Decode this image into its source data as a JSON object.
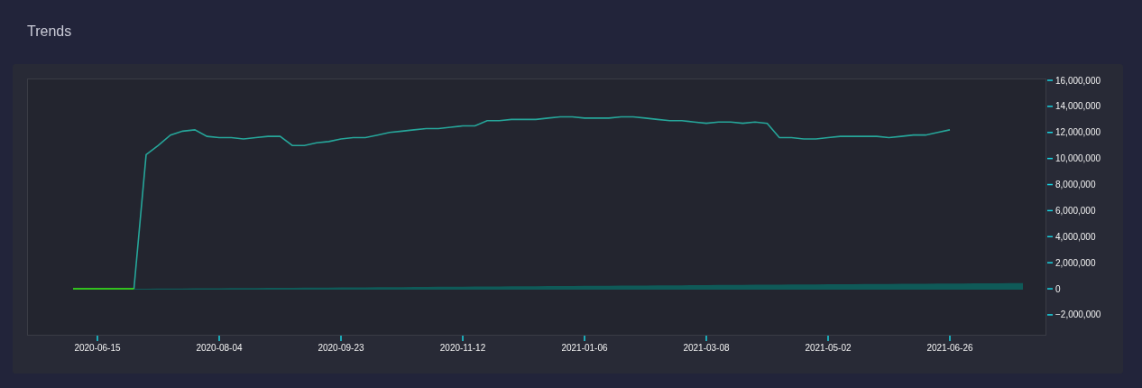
{
  "header": {
    "title": "Trends"
  },
  "chart": {
    "chart_data": {
      "type": "line",
      "ylim": [
        -3530000,
        16140000
      ],
      "categories": [
        null,
        null,
        null,
        null,
        null,
        null,
        "2020-06-15",
        null,
        null,
        null,
        null,
        null,
        null,
        null,
        null,
        null,
        "2020-08-04",
        null,
        null,
        null,
        null,
        null,
        null,
        null,
        null,
        null,
        "2020-09-23",
        null,
        null,
        null,
        null,
        null,
        null,
        null,
        null,
        null,
        "2020-11-12",
        null,
        null,
        null,
        null,
        null,
        null,
        null,
        null,
        null,
        "2021-01-06",
        null,
        null,
        null,
        null,
        null,
        null,
        null,
        null,
        null,
        "2021-03-08",
        null,
        null,
        null,
        null,
        null,
        null,
        null,
        null,
        null,
        "2021-05-02",
        null,
        null,
        null,
        null,
        null,
        null,
        null,
        null,
        null,
        "2021-06-26",
        null,
        null,
        null,
        null,
        null,
        null
      ],
      "yticks": [
        {
          "value": -2000000,
          "label": "−2,000,000"
        },
        {
          "value": 0,
          "label": "0"
        },
        {
          "value": 2000000,
          "label": "2,000,000"
        },
        {
          "value": 4000000,
          "label": "4,000,000"
        },
        {
          "value": 6000000,
          "label": "6,000,000"
        },
        {
          "value": 8000000,
          "label": "8,000,000"
        },
        {
          "value": 10000000,
          "label": "10,000,000"
        },
        {
          "value": 12000000,
          "label": "12,000,000"
        },
        {
          "value": 14000000,
          "label": "14,000,000"
        },
        {
          "value": 16000000,
          "label": "16,000,000"
        }
      ],
      "series": [
        {
          "type": "line",
          "color": "#26a69a",
          "values": [
            null,
            null,
            null,
            null,
            null,
            null,
            null,
            null,
            null,
            0,
            10300000,
            11000000,
            11800000,
            12100000,
            12200000,
            11700000,
            11600000,
            11600000,
            11500000,
            11600000,
            11700000,
            11700000,
            11000000,
            11000000,
            11200000,
            11300000,
            11500000,
            11600000,
            11600000,
            11800000,
            12000000,
            12100000,
            12200000,
            12300000,
            12300000,
            12400000,
            12500000,
            12500000,
            12900000,
            12900000,
            13000000,
            13000000,
            13000000,
            13100000,
            13200000,
            13200000,
            13100000,
            13100000,
            13100000,
            13200000,
            13200000,
            13100000,
            13000000,
            12900000,
            12900000,
            12800000,
            12700000,
            12800000,
            12800000,
            12700000,
            12800000,
            12700000,
            11600000,
            11600000,
            11500000,
            11500000,
            11600000,
            11700000,
            11700000,
            11700000,
            11700000,
            11600000,
            11700000,
            11800000,
            11800000,
            12000000,
            12200000,
            null,
            null,
            null,
            null,
            null,
            null
          ]
        },
        {
          "type": "area",
          "color": "#0f5a58",
          "values": [
            null,
            null,
            null,
            null,
            null,
            null,
            null,
            null,
            null,
            0,
            6000,
            12000,
            18000,
            24000,
            30000,
            36000,
            42000,
            48000,
            54000,
            60000,
            66000,
            72000,
            78000,
            84000,
            90000,
            96000,
            102000,
            108000,
            114000,
            120000,
            126000,
            132000,
            138000,
            144000,
            150000,
            156000,
            162000,
            168000,
            174000,
            180000,
            186000,
            192000,
            198000,
            204000,
            210000,
            216000,
            222000,
            228000,
            234000,
            240000,
            246000,
            252000,
            258000,
            264000,
            270000,
            276000,
            282000,
            288000,
            294000,
            300000,
            306000,
            312000,
            318000,
            324000,
            330000,
            336000,
            342000,
            348000,
            354000,
            360000,
            366000,
            372000,
            378000,
            384000,
            390000,
            396000,
            402000,
            408000,
            414000,
            420000,
            426000,
            432000,
            438000
          ]
        },
        {
          "type": "line",
          "color": "#39f51a",
          "values": [
            null,
            null,
            null,
            null,
            0,
            0,
            0,
            0,
            0,
            0,
            null,
            null,
            null,
            null,
            null,
            null,
            null,
            null,
            null,
            null,
            null,
            null,
            null,
            null,
            null,
            null,
            null,
            null,
            null,
            null,
            null,
            null,
            null,
            null,
            null,
            null,
            null,
            null,
            null,
            null,
            null,
            null,
            null,
            null,
            null,
            null,
            null,
            null,
            null,
            null,
            null,
            null,
            null,
            null,
            null,
            null,
            null,
            null,
            null,
            null,
            null,
            null,
            null,
            null,
            null,
            null,
            null,
            null,
            null,
            null,
            null,
            null,
            null,
            null,
            null,
            null,
            null,
            null,
            null,
            null,
            null,
            null,
            null
          ]
        }
      ]
    }
  }
}
